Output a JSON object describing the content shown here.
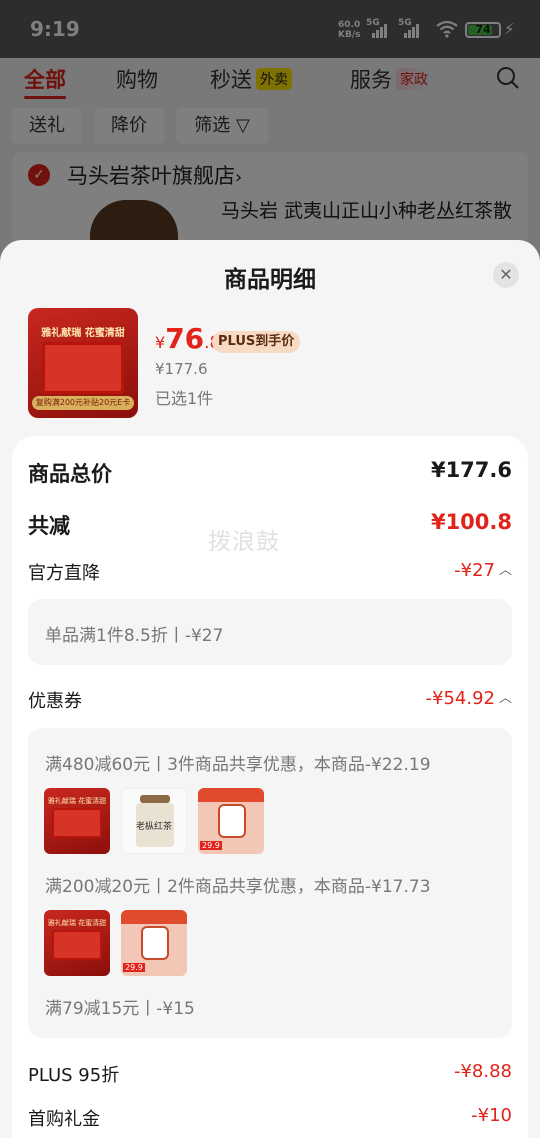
{
  "status_bar": {
    "time": "9:19",
    "net_speed": "60.0",
    "net_unit": "KB/s",
    "sim1": "5G",
    "sim2": "5G",
    "battery": "74"
  },
  "background": {
    "tabs": [
      "全部",
      "购物",
      "秒送",
      "服务"
    ],
    "tab_tags": {
      "miaosong": "外卖",
      "fuwu": "家政"
    },
    "filters": [
      "送礼",
      "降价",
      "筛选"
    ],
    "shop_name": "马头岩茶叶旗舰店",
    "shop_chevron": "›",
    "product_title": "马头岩 武夷山正山小种老丛红茶散"
  },
  "sheet": {
    "title": "商品明细",
    "close_icon": "✕",
    "product": {
      "thumb_text_top": "雅礼献瑞 花蜜清甜",
      "thumb_text_bottom": "复购满200元补贴20元E卡",
      "price_symbol": "¥",
      "price_int": "76",
      "price_dec": ".8",
      "plus_label": "PLUS到手价",
      "original_price": "¥177.6",
      "selected_qty": "已选1件"
    },
    "details": {
      "total_label": "商品总价",
      "total_value": "¥177.6",
      "discount_label": "共减",
      "discount_value": "¥100.8",
      "watermark": "拨浪鼓",
      "official_label": "官方直降",
      "official_value": "-¥27",
      "official_detail": "单品满1件8.5折丨-¥27",
      "coupon_label": "优惠券",
      "coupon_value": "-¥54.92",
      "coupon_detail_1": "满480减60元丨3件商品共享优惠，本商品-¥22.19",
      "coupon_detail_2": "满200减20元丨2件商品共享优惠，本商品-¥17.73",
      "coupon_detail_3": "满79减15元丨-¥15",
      "tin_label": "老枞红茶",
      "pink_badge": "29.9",
      "plus_discount_label": "PLUS 95折",
      "plus_discount_value": "-¥8.88",
      "first_buy_label": "首购礼金",
      "first_buy_value": "-¥10"
    }
  },
  "colors": {
    "accent_red": "#e2231a",
    "battery_green": "#49c24a"
  }
}
